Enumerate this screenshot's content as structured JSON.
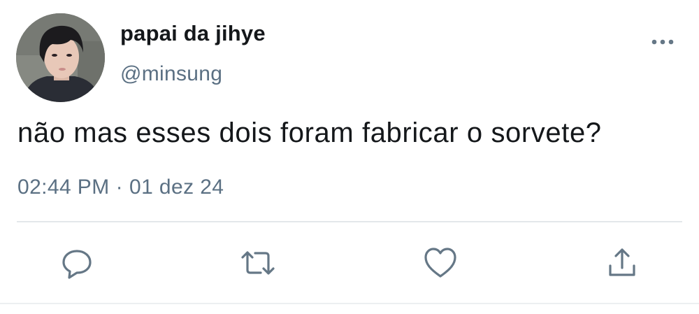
{
  "tweet": {
    "display_name": "papai da jihye",
    "handle": "@minsung",
    "text": "não mas esses dois foram fabricar o sorvete?",
    "time": "02:44 PM",
    "separator": "·",
    "date": "01 dez 24"
  },
  "icons": {
    "more": "more-horizontal-icon",
    "reply": "reply-icon",
    "retweet": "retweet-icon",
    "like": "heart-icon",
    "share": "share-icon"
  },
  "colors": {
    "text": "#14171a",
    "secondary": "#5b7083",
    "icon": "#657786",
    "divider": "#e3e7ea"
  }
}
